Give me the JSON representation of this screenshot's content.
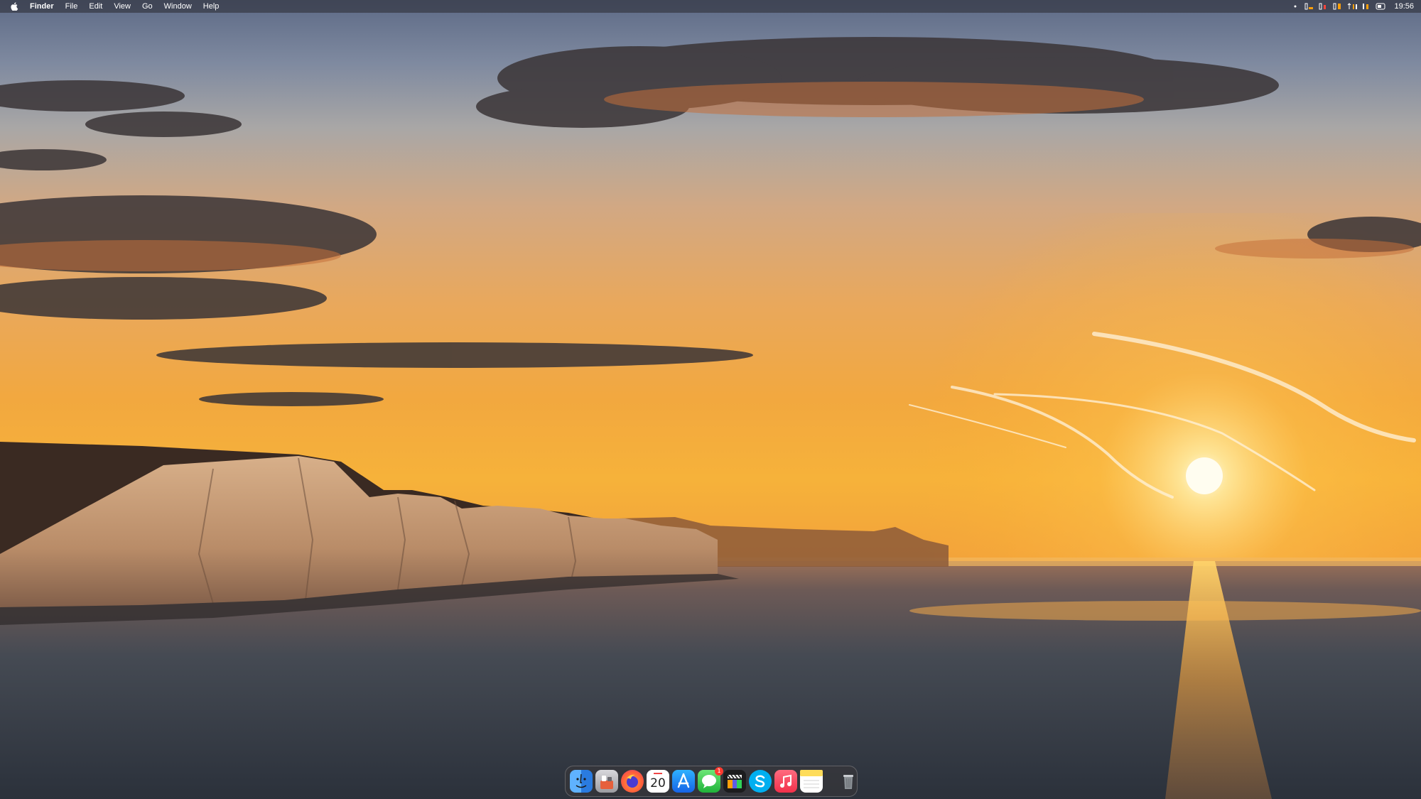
{
  "menubar": {
    "app_name": "Finder",
    "items": [
      "File",
      "Edit",
      "View",
      "Go",
      "Window",
      "Help"
    ],
    "clock": "19:56",
    "status_icons": [
      "dot-icon",
      "battery-icon",
      "cpu-icon",
      "memory-icon",
      "network-icon",
      "sensors-icon",
      "control-center-icon"
    ]
  },
  "dock": {
    "apps": [
      {
        "name": "finder-icon",
        "color": "#3d8ef0"
      },
      {
        "name": "launchpad-icon",
        "color": "#c7c7cc"
      },
      {
        "name": "firefox-icon",
        "color": "#ff7139"
      },
      {
        "name": "calendar-icon",
        "color": "#ffffff",
        "day": "20"
      },
      {
        "name": "app-store-icon",
        "color": "#1e8cf7"
      },
      {
        "name": "messages-icon",
        "color": "#34c759",
        "badge": "1"
      },
      {
        "name": "final-cut-icon",
        "color": "#1c1c1e"
      },
      {
        "name": "skype-icon",
        "color": "#00aff0"
      },
      {
        "name": "music-icon",
        "color": "#fa3c55"
      },
      {
        "name": "notes-icon",
        "color": "#fedc5a"
      }
    ],
    "trash": {
      "name": "trash-icon",
      "color": "#9aa0a6"
    }
  },
  "colors": {
    "sun": "#fff6d8",
    "cliff_shadow": "#3a2a22",
    "cliff_face": "#c9a27e",
    "sea": "#3a3f48"
  }
}
